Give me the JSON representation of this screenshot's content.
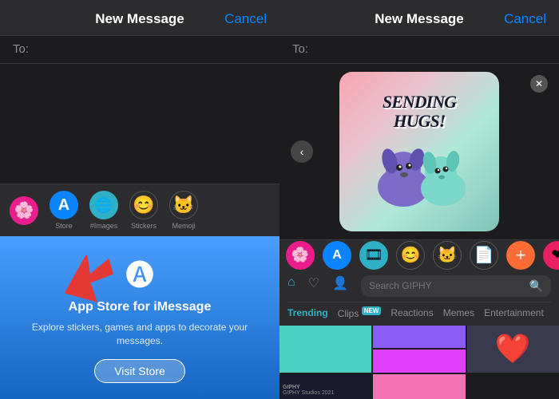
{
  "left_panel": {
    "header": {
      "title": "New Message",
      "cancel_label": "Cancel"
    },
    "to_label": "To:",
    "app_icons": [
      {
        "id": "photos",
        "label": "Photos",
        "color": "pink",
        "emoji": "🌸"
      },
      {
        "id": "store",
        "label": "Store",
        "color": "blue",
        "emoji": "🅐"
      },
      {
        "id": "images",
        "label": "#Images",
        "color": "green-blue",
        "emoji": "🌐"
      },
      {
        "id": "stickers",
        "label": "Stickers",
        "color": "emoji",
        "emoji": "😊"
      },
      {
        "id": "memoji",
        "label": "Memoji",
        "color": "emoji",
        "emoji": "🐱"
      }
    ],
    "appstore": {
      "title": "App Store for iMessage",
      "description": "Explore stickers, games and apps to decorate your messages.",
      "visit_label": "Visit Store"
    }
  },
  "right_panel": {
    "header": {
      "title": "New Message",
      "cancel_label": "Cancel"
    },
    "to_label": "To:",
    "sticker": {
      "text_line1": "SENDING",
      "text_line2": "HUGS!"
    },
    "app_icons": [
      {
        "id": "photos",
        "color": "pink",
        "emoji": "🌸"
      },
      {
        "id": "store",
        "color": "blue",
        "emoji": "🅐"
      },
      {
        "id": "giphy",
        "color": "green-blue",
        "emoji": "🎞"
      },
      {
        "id": "stickers",
        "emoji": "😊"
      },
      {
        "id": "memoji",
        "emoji": "🐱"
      },
      {
        "id": "file",
        "emoji": "📄"
      },
      {
        "id": "plus",
        "emoji": "➕"
      },
      {
        "id": "heart",
        "emoji": "❤"
      }
    ],
    "giphy": {
      "search_placeholder": "Search GIPHY",
      "tabs": [
        {
          "label": "Trending",
          "active": true
        },
        {
          "label": "Clips",
          "badge": "NEW"
        },
        {
          "label": "Reactions"
        },
        {
          "label": "Memes"
        },
        {
          "label": "Entertainment"
        }
      ],
      "credit_channel": "GIPHY Studios 2021"
    }
  },
  "arrow": {
    "color": "#e53935"
  }
}
